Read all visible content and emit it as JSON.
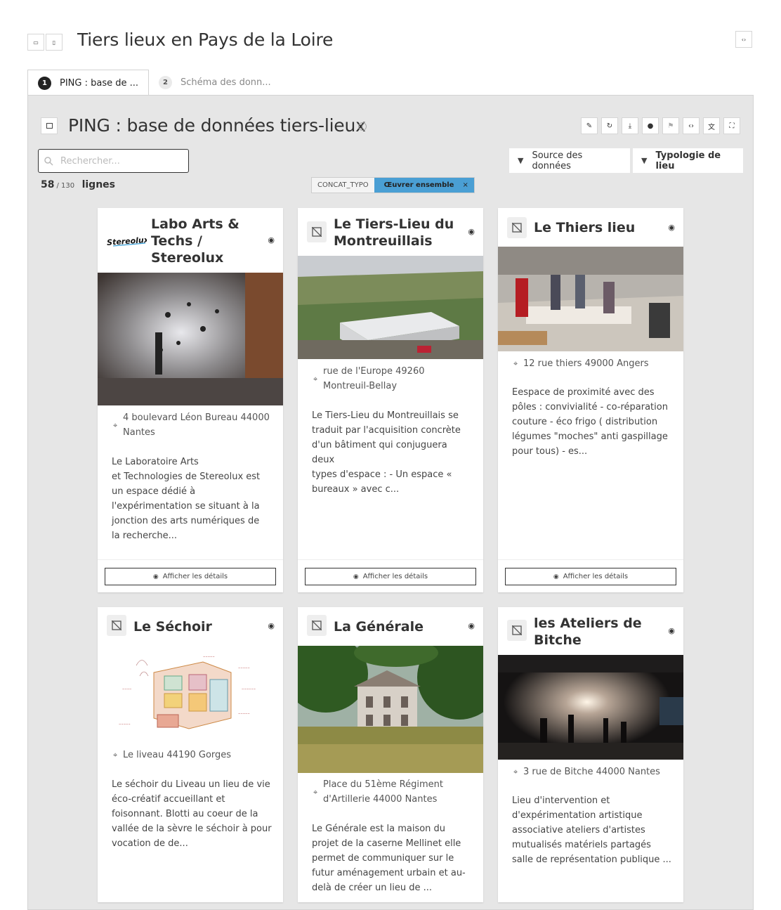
{
  "header": {
    "title": "Tiers lieux en Pays de la Loire"
  },
  "tabs": [
    {
      "num": "1",
      "label": "PING : base de ..."
    },
    {
      "num": "2",
      "label": "Schéma des donn..."
    }
  ],
  "panel": {
    "title": "PING : base de données tiers-lieux",
    "search_placeholder": "Rechercher...",
    "count_shown": "58",
    "count_total": "/ 130",
    "count_label": "lignes",
    "filters": [
      "Source des données",
      "Typologie de lieu"
    ],
    "active_filter": {
      "key": "CONCAT_TYPO",
      "value": "Œuvrer ensemble",
      "remove": "×"
    }
  },
  "details_label": "Afficher les détails",
  "cards": [
    {
      "title_lines": [
        "Labo Arts &",
        "Techs /",
        "Stereolux"
      ],
      "logo_text": "Stereolux",
      "address_lines": [
        "4 boulevard Léon Bureau 44000",
        "Nantes"
      ],
      "description_lines": [
        "Le Laboratoire Arts",
        "et Technologies de Stereolux est",
        "un espace dédié à",
        "l'expérimentation se situant à la",
        "jonction des arts numériques de",
        "la recherche..."
      ]
    },
    {
      "title_lines": [
        "Le Tiers-Lieu du",
        "Montreuillais"
      ],
      "address_lines": [
        "rue de l'Europe 49260",
        "Montreuil-Bellay"
      ],
      "description_lines": [
        "Le Tiers-Lieu du Montreuillais se",
        "traduit par l'acquisition concrète",
        "d'un bâtiment qui conjuguera deux",
        "types d'espace : - Un espace «",
        "bureaux » avec c..."
      ]
    },
    {
      "title_lines": [
        "Le Thiers lieu"
      ],
      "address_lines": [
        "12 rue thiers 49000 Angers"
      ],
      "description_lines": [
        "Eespace de proximité avec des",
        "pôles : convivialité - co-réparation",
        "couture - éco frigo ( distribution",
        "légumes \"moches\" anti gaspillage",
        "pour tous) - es..."
      ]
    },
    {
      "title_lines": [
        "Le Séchoir"
      ],
      "address_lines": [
        "Le liveau 44190 Gorges"
      ],
      "description_lines": [
        "Le séchoir du Liveau un lieu de vie",
        "éco-créatif accueillant et",
        "foisonnant. Blotti au coeur de la",
        "vallée de la sèvre le séchoir à pour",
        "vocation de de..."
      ]
    },
    {
      "title_lines": [
        "La Générale"
      ],
      "address_lines": [
        "Place du 51ème Régiment",
        "d'Artillerie 44000 Nantes"
      ],
      "description_lines": [
        "Le Générale est la maison du",
        "projet de la caserne Mellinet elle",
        "permet de communiquer sur le",
        "futur aménagement urbain et au-",
        "delà de créer un lieu de ..."
      ]
    },
    {
      "title_lines": [
        "les Ateliers de",
        "Bitche"
      ],
      "address_lines": [
        "3 rue de Bitche 44000 Nantes"
      ],
      "description_lines": [
        "Lieu d'intervention et",
        "d'expérimentation artistique",
        "associative ateliers d'artistes",
        "mutualisés matériels partagés",
        "salle de représentation publique ..."
      ]
    }
  ]
}
